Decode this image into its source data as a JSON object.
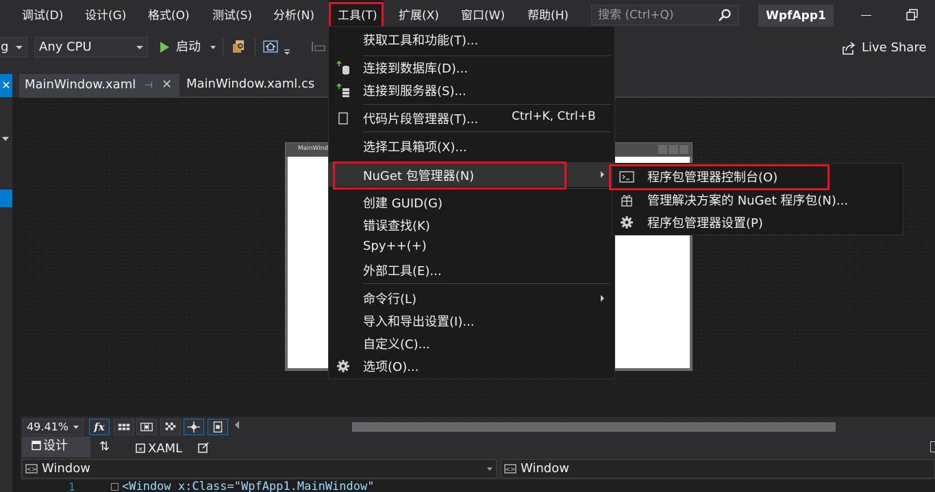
{
  "menubar": {
    "items": [
      {
        "id": "debug",
        "label": "调试(D)"
      },
      {
        "id": "design",
        "label": "设计(G)"
      },
      {
        "id": "format",
        "label": "格式(O)"
      },
      {
        "id": "test",
        "label": "测试(S)"
      },
      {
        "id": "analyze",
        "label": "分析(N)"
      },
      {
        "id": "tools",
        "label": "工具(T)"
      },
      {
        "id": "extensions",
        "label": "扩展(X)"
      },
      {
        "id": "window",
        "label": "窗口(W)"
      },
      {
        "id": "help",
        "label": "帮助(H)"
      }
    ],
    "search_placeholder": "搜索 (Ctrl+Q)",
    "solution_name": "WpfApp1"
  },
  "toolbar": {
    "config_partial": "g",
    "platform": "Any CPU",
    "start_label": "启动",
    "live_share_label": "Live Share"
  },
  "tabs": [
    {
      "label": "MainWindow.xaml",
      "active": true
    },
    {
      "label": "MainWindow.xaml.cs",
      "active": false
    }
  ],
  "designer": {
    "preview_title": "MainWindo",
    "zoom": "49.41%",
    "fx_label": "fx"
  },
  "split_tabs": {
    "design_label": "设计",
    "swap_label": "⇅",
    "xaml_label": "XAML"
  },
  "nav": {
    "left": "Window",
    "right": "Window"
  },
  "code": {
    "line_number": "1",
    "line_text": "<Window x:Class=\"WpfApp1.MainWindow\""
  },
  "tools_menu": {
    "items": [
      {
        "label": "获取工具和功能(T)...",
        "icon": "none"
      },
      {
        "label": "连接到数据库(D)...",
        "icon": "database-connect-icon"
      },
      {
        "label": "连接到服务器(S)...",
        "icon": "server-connect-icon"
      },
      {
        "label": "代码片段管理器(T)...",
        "shortcut": "Ctrl+K, Ctrl+B",
        "icon": "snippet-icon"
      },
      {
        "label": "选择工具箱项(X)...",
        "icon": "none"
      },
      {
        "label": "NuGet 包管理器(N)",
        "icon": "none",
        "submenu": true
      },
      {
        "label": "创建 GUID(G)",
        "icon": "none"
      },
      {
        "label": "错误查找(K)",
        "icon": "none"
      },
      {
        "label": "Spy++(+)",
        "icon": "none"
      },
      {
        "label": "外部工具(E)...",
        "icon": "none"
      },
      {
        "label": "命令行(L)",
        "icon": "none",
        "submenu": true
      },
      {
        "label": "导入和导出设置(I)...",
        "icon": "none"
      },
      {
        "label": "自定义(C)...",
        "icon": "none"
      },
      {
        "label": "选项(O)...",
        "icon": "gear-icon"
      }
    ]
  },
  "nuget_submenu": {
    "items": [
      {
        "label": "程序包管理器控制台(O)",
        "icon": "console-icon"
      },
      {
        "label": "管理解决方案的 NuGet 程序包(N)...",
        "icon": "package-icon"
      },
      {
        "label": "程序包管理器设置(P)",
        "icon": "gear-icon"
      }
    ]
  },
  "colors": {
    "highlight_red": "#e81123",
    "accent_blue": "#007acc",
    "menu_bg": "#1b1b1c",
    "chrome_bg": "#2d2d30"
  }
}
